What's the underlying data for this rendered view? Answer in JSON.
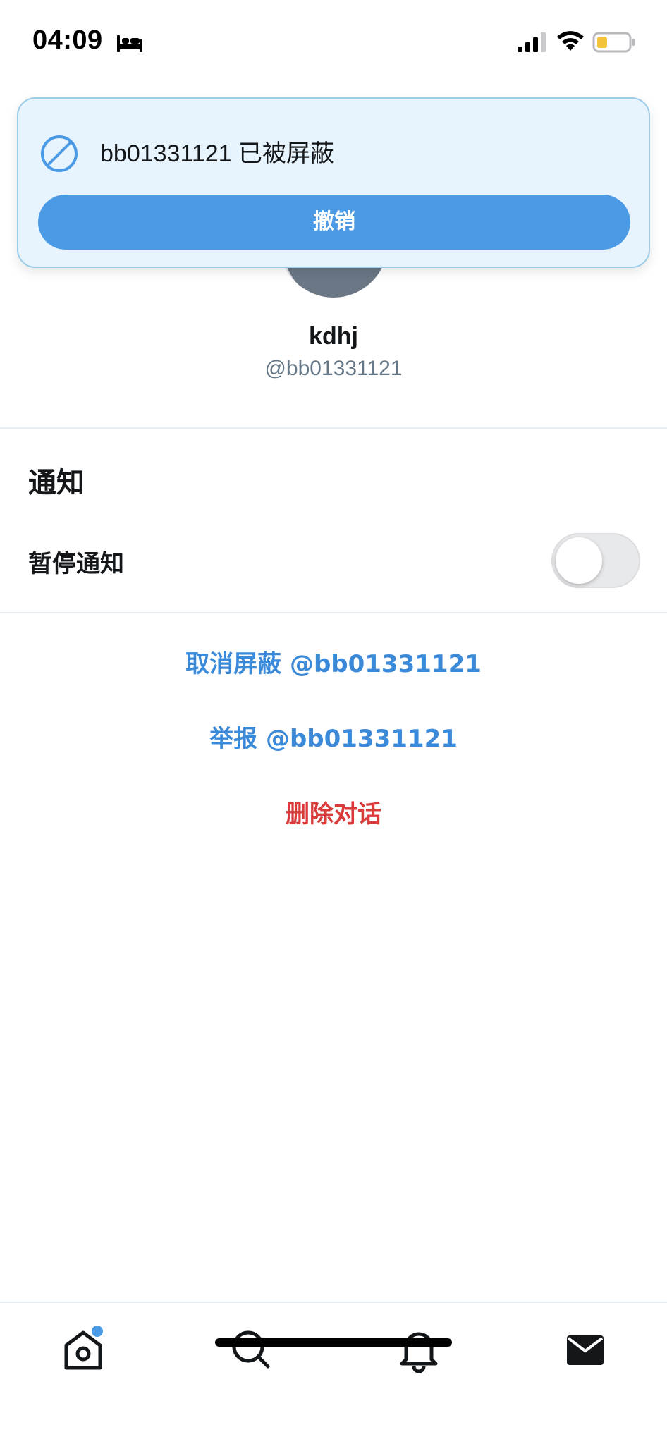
{
  "status_bar": {
    "time": "04:09",
    "icons": [
      "bed-icon",
      "signal-icon",
      "wifi-icon",
      "battery-icon"
    ]
  },
  "toast": {
    "message": "bb01331121 已被屏蔽",
    "undo_label": "撤销",
    "icon": "block-icon"
  },
  "profile": {
    "name": "kdhj",
    "handle": "@bb01331121"
  },
  "notifications": {
    "section_title": "通知",
    "mute_label": "暂停通知",
    "mute_enabled": false
  },
  "actions": {
    "unblock": "取消屏蔽 @bb01331121",
    "report": "举报 @bb01331121",
    "delete": "删除对话"
  },
  "tab_bar": {
    "tabs": [
      "home-icon",
      "search-icon",
      "bell-icon",
      "mail-icon"
    ]
  },
  "colors": {
    "accent": "#4a9ae6",
    "link": "#3b8ad9",
    "danger": "#d93a3a",
    "toast_bg": "#e8f4fd"
  }
}
